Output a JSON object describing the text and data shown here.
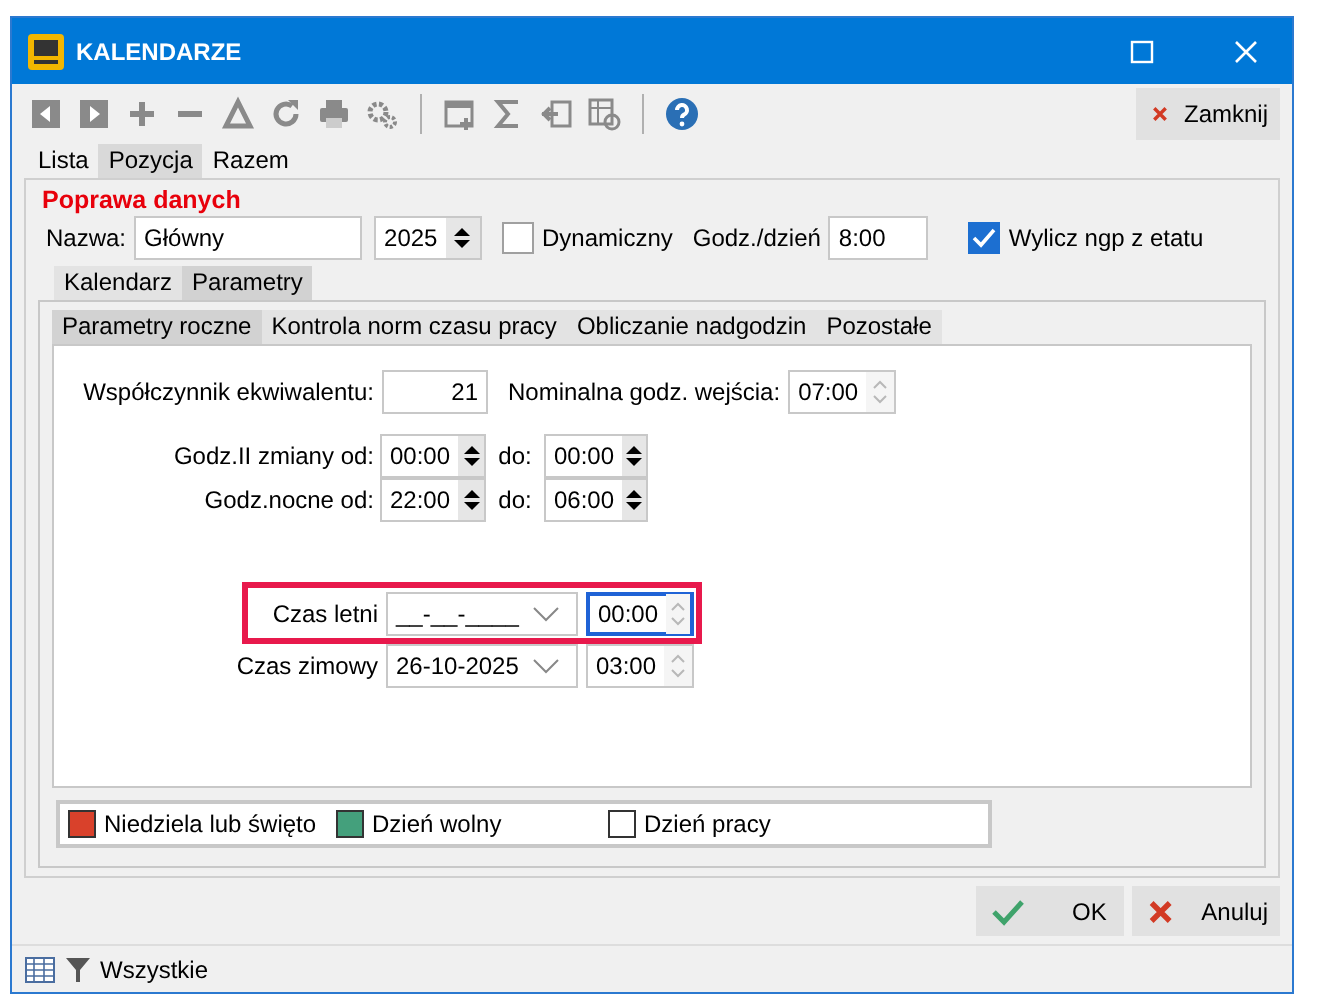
{
  "window": {
    "title": "KALENDARZE"
  },
  "toolbar": {
    "close_button": "Zamknij"
  },
  "tabs": [
    {
      "label": "Lista",
      "selected": false
    },
    {
      "label": "Pozycja",
      "selected": true
    },
    {
      "label": "Razem",
      "selected": false
    }
  ],
  "group": {
    "title": "Poprawa danych",
    "name_label": "Nazwa:",
    "name_value": "Główny",
    "year": "2025",
    "dynamic": {
      "label": "Dynamiczny",
      "checked": false
    },
    "hours_label": "Godz./dzień",
    "hours_value": "8:00",
    "compute": {
      "label": "Wylicz ngp z etatu",
      "checked": true
    }
  },
  "sub_tabs": [
    {
      "label": "Kalendarz",
      "selected": false
    },
    {
      "label": "Parametry",
      "selected": true
    }
  ],
  "param_tabs": [
    {
      "label": "Parametry roczne",
      "selected": true
    },
    {
      "label": "Kontrola norm czasu pracy",
      "selected": false
    },
    {
      "label": "Obliczanie nadgodzin",
      "selected": false
    },
    {
      "label": "Pozostałe",
      "selected": false
    }
  ],
  "params": {
    "coef_label": "Współczynnik ekwiwalentu:",
    "coef_value": "21",
    "entry_label": "Nominalna godz. wejścia:",
    "entry_value": "07:00",
    "entry_spinner_enabled": false,
    "ranges": [
      {
        "label": "Godz.II zmiany od:",
        "from": "00:00",
        "to_label": "do:",
        "to": "00:00"
      },
      {
        "label": "Godz.nocne od:",
        "from": "22:00",
        "to_label": "do:",
        "to": "06:00"
      }
    ],
    "summer": {
      "label": "Czas letni",
      "date": "__-__-____",
      "time": "00:00",
      "highlighted": true,
      "focused": true
    },
    "winter": {
      "label": "Czas zimowy",
      "date": "26-10-2025",
      "time": "03:00",
      "highlighted": false,
      "focused": false
    }
  },
  "legend": [
    {
      "label": "Niedziela lub święto",
      "color": "#d9412b"
    },
    {
      "label": "Dzień wolny",
      "color": "#44a07c"
    },
    {
      "label": "Dzień pracy",
      "color": "#ffffff"
    }
  ],
  "buttons": [
    {
      "label": "OK",
      "kind": "ok"
    },
    {
      "label": "Anuluj",
      "kind": "cancel"
    }
  ],
  "status_bar": {
    "filter": "Wszystkie"
  }
}
